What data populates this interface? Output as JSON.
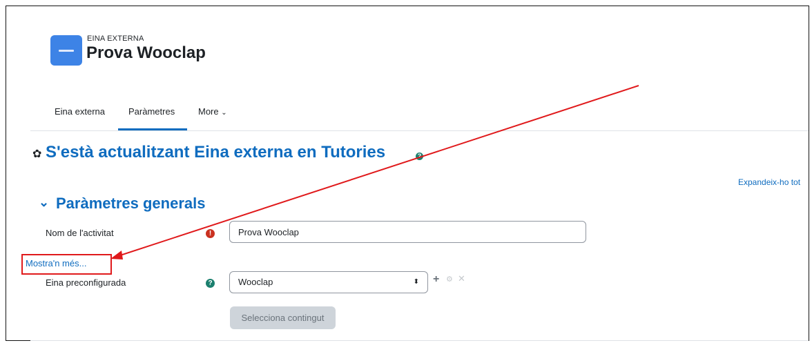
{
  "activity": {
    "kicker": "EINA EXTERNA",
    "title": "Prova Wooclap"
  },
  "tabs": [
    {
      "label": "Eina externa",
      "active": false
    },
    {
      "label": "Paràmetres",
      "active": true
    },
    {
      "label": "More",
      "active": false
    }
  ],
  "page": {
    "heading": "S'està actualitzant Eina externa en Tutories",
    "expand_all": "Expandeix-ho tot"
  },
  "section": {
    "title": "Paràmetres generals",
    "name_label": "Nom de l'activitat",
    "name_value": "Prova Wooclap",
    "show_more": "Mostra'n més...",
    "preconfig_label": "Eina preconfigurada",
    "preconfig_value": "Wooclap",
    "select_content_button": "Selecciona contingut"
  },
  "colors": {
    "accent": "#0f6cbf",
    "annotation": "#e0191b",
    "required": "#ca3120",
    "help": "#1b7f6e"
  },
  "icons": {
    "tab_more": "chevron-down-icon",
    "section_toggle": "chevron-down-icon",
    "required": "exclamation-circle-icon",
    "help": "question-circle-icon",
    "add": "plus-icon",
    "edit": "gear-icon",
    "delete": "close-icon"
  }
}
